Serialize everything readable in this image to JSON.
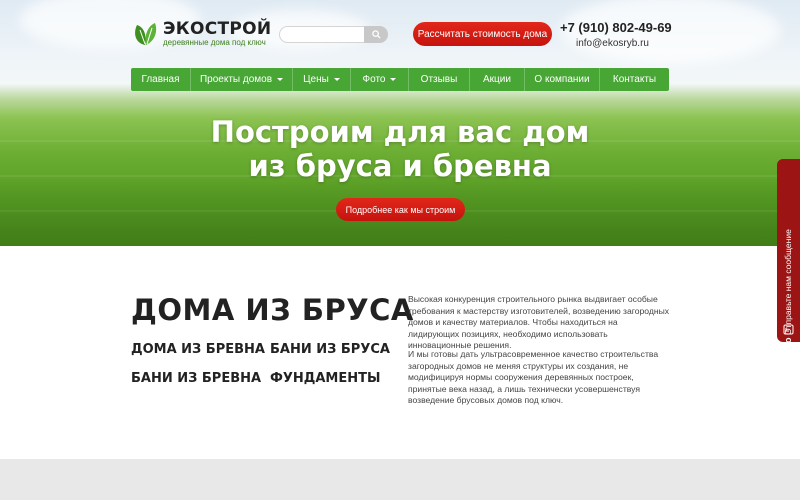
{
  "header": {
    "logo_title": "ЭКОСТРОЙ",
    "logo_subtitle": "деревянные дома под ключ",
    "search_placeholder": "",
    "calc_button": "Рассчитать стоимость дома",
    "phone": "+7 (910) 802-49-69",
    "email": "info@ekosryb.ru"
  },
  "nav": {
    "items": [
      {
        "label": "Главная",
        "dropdown": false
      },
      {
        "label": "Проекты домов",
        "dropdown": true
      },
      {
        "label": "Цены",
        "dropdown": true
      },
      {
        "label": "Фото",
        "dropdown": true
      },
      {
        "label": "Отзывы",
        "dropdown": false
      },
      {
        "label": "Акции",
        "dropdown": false
      },
      {
        "label": "О компании",
        "dropdown": false
      },
      {
        "label": "Контакты",
        "dropdown": false
      }
    ]
  },
  "hero": {
    "title_line1": "Построим для вас дом",
    "title_line2": "из бруса и бревна",
    "button": "Подробнее как мы строим"
  },
  "content": {
    "heading": "ДОМА ИЗ БРУСА",
    "links": [
      "ДОМА ИЗ БРЕВНА",
      "БАНИ ИЗ БРУСА",
      "БАНИ ИЗ БРЕВНА",
      "ФУНДАМЕНТЫ"
    ],
    "paragraph1": "Высокая конкуренция строительного рынка выдвигает особые требования к мастерству изготовителей, возведению загородных домов и качеству материалов. Чтобы находиться на лидирующих позициях, необходимо использовать инновационные решения.",
    "paragraph2": "И мы готовы дать ультрасовременное качество строительства загородных домов не меняя структуры их создания, не модифицируя нормы сооружения деревянных построек, принятые века назад, а лишь технически усовершенствуя возведение брусовых домов под ключ."
  },
  "jivo": {
    "label": "Отправьте нам сообщение",
    "logo": "jivo"
  },
  "colors": {
    "brand_green": "#47a634",
    "accent_red": "#d21c13",
    "jivo": "#9c1414"
  }
}
